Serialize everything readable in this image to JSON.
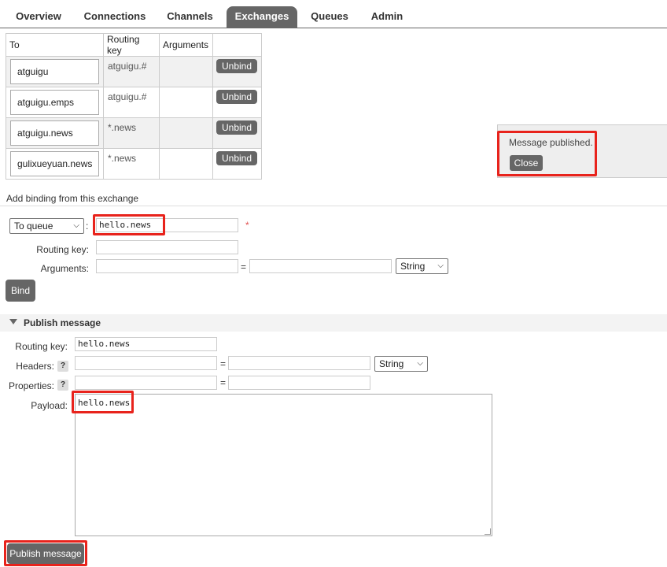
{
  "tabs": [
    {
      "label": "Overview"
    },
    {
      "label": "Connections"
    },
    {
      "label": "Channels"
    },
    {
      "label": "Exchanges",
      "active": true
    },
    {
      "label": "Queues"
    },
    {
      "label": "Admin"
    }
  ],
  "bindings": {
    "headers": [
      "To",
      "Routing key",
      "Arguments",
      ""
    ],
    "rows": [
      {
        "to": "atguigu",
        "routing_key": "atguigu.#",
        "arguments": "",
        "action": "Unbind"
      },
      {
        "to": "atguigu.emps",
        "routing_key": "atguigu.#",
        "arguments": "",
        "action": "Unbind"
      },
      {
        "to": "atguigu.news",
        "routing_key": "*.news",
        "arguments": "",
        "action": "Unbind"
      },
      {
        "to": "gulixueyuan.news",
        "routing_key": "*.news",
        "arguments": "",
        "action": "Unbind"
      }
    ]
  },
  "notice": {
    "text": "Message published.",
    "close_label": "Close"
  },
  "add_binding": {
    "title": "Add binding from this exchange",
    "destination_type": "To queue",
    "destination_name": "hello.news",
    "required_mark": "*",
    "routing_key_label": "Routing key:",
    "routing_key_value": "",
    "arguments_label": "Arguments:",
    "equals": "=",
    "arg_type": "String",
    "bind_label": "Bind",
    "colon": ":"
  },
  "publish": {
    "title": "Publish message",
    "routing_key_label": "Routing key:",
    "routing_key_value": "hello.news",
    "headers_label": "Headers:",
    "headers_type": "String",
    "properties_label": "Properties:",
    "help": "?",
    "equals": "=",
    "payload_label": "Payload:",
    "payload_value": "hello.news",
    "publish_label": "Publish message"
  },
  "colors": {
    "accent": "#666666",
    "highlight": "#e8231c",
    "required": "#e05050"
  }
}
